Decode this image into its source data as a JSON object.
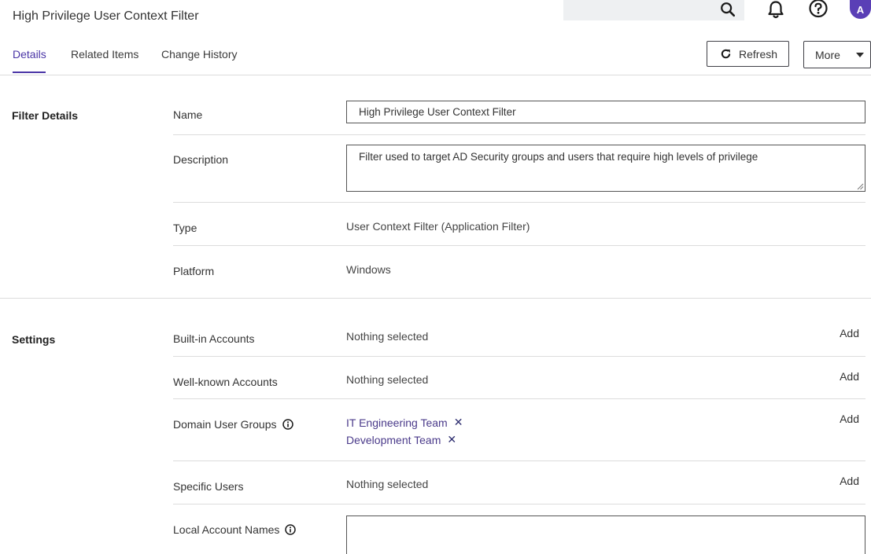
{
  "header": {
    "title": "High Privilege User Context Filter",
    "search_placeholder": "",
    "avatar_initial": "A"
  },
  "tabs": [
    {
      "label": "Details",
      "active": true
    },
    {
      "label": "Related Items",
      "active": false
    },
    {
      "label": "Change History",
      "active": false
    }
  ],
  "actions": {
    "refresh_label": "Refresh",
    "more_label": "More"
  },
  "filter_details": {
    "section_title": "Filter Details",
    "name_label": "Name",
    "name_value": "High Privilege User Context Filter",
    "description_label": "Description",
    "description_value": "Filter used to target AD Security groups and users that require high levels of privilege",
    "type_label": "Type",
    "type_value": "User Context Filter (Application Filter)",
    "platform_label": "Platform",
    "platform_value": "Windows"
  },
  "settings": {
    "section_title": "Settings",
    "builtin_label": "Built-in Accounts",
    "builtin_value": "Nothing selected",
    "wellknown_label": "Well-known Accounts",
    "wellknown_value": "Nothing selected",
    "domain_groups_label": "Domain User Groups",
    "domain_groups": [
      "IT Engineering Team",
      "Development Team"
    ],
    "specific_users_label": "Specific Users",
    "specific_users_value": "Nothing selected",
    "local_accounts_label": "Local Account Names",
    "local_accounts_value": "",
    "add_label": "Add",
    "remove_glyph": "✕"
  },
  "colors": {
    "accent": "#4a35a6",
    "avatar_bg": "#5a3fb6"
  }
}
